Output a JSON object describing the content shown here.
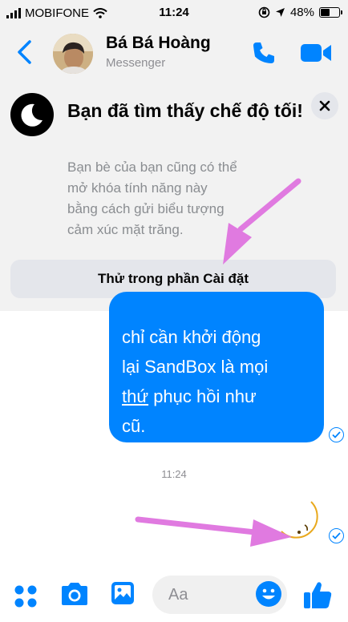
{
  "status_bar": {
    "carrier": "MOBIFONE",
    "time": "11:24",
    "battery": "48%",
    "battery_level": 0.48
  },
  "header": {
    "contact_name": "Bá Bá Hoàng",
    "subtitle": "Messenger",
    "accent_color": "#0084ff"
  },
  "dark_mode_card": {
    "title": "Bạn đã tìm thấy chế độ tối!",
    "body_lines": [
      "Bạn bè của bạn cũng có thể",
      "mở khóa tính năng này",
      "bằng cách gửi biểu tượng",
      "cảm xúc mặt trăng."
    ],
    "button_label": "Thử trong phần Cài đặt",
    "close_icon": "close-icon"
  },
  "chat": {
    "message_lines": [
      "chỉ cần khởi động",
      "lại SandBox là mọi",
      "thứ",
      " phục hồi như",
      "cũ."
    ],
    "timestamp": "11:24",
    "sent_emoji": "crescent-moon",
    "bubble_color": "#0084ff"
  },
  "composer": {
    "placeholder": "Aa"
  },
  "annotations": {
    "arrow_color": "#e87be8"
  }
}
